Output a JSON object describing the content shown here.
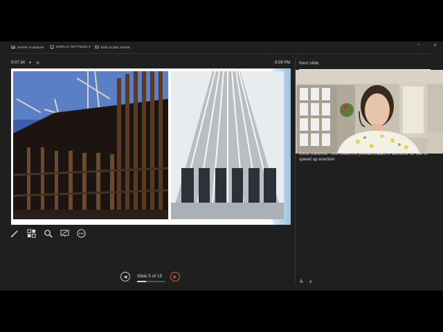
{
  "toolbar": {
    "show_taskbar": "SHOW TASKBAR",
    "display_settings": "DISPLAY SETTINGS ▾",
    "end_slide_show": "END SLIDE SHOW",
    "minimize": "–",
    "close": "✕"
  },
  "status": {
    "elapsed": "0:07:34",
    "pause_icon": "pause-icon",
    "restart_icon": "restart-icon",
    "clock": "8:09 PM"
  },
  "navigation": {
    "slide_counter": "Slide 5 of 15",
    "current_slide": 5,
    "total_slides": 15,
    "prev_icon": "◀",
    "next_icon": "▶"
  },
  "next_slide": {
    "label": "Next slide"
  },
  "notes": {
    "text": "IOnic columns - box columns, prefabricated in sections off site to speed up erection"
  },
  "font_controls": {
    "increase": "A",
    "decrease": "A"
  },
  "colors": {
    "accent": "#e3573d",
    "background": "#1f1f1f"
  }
}
